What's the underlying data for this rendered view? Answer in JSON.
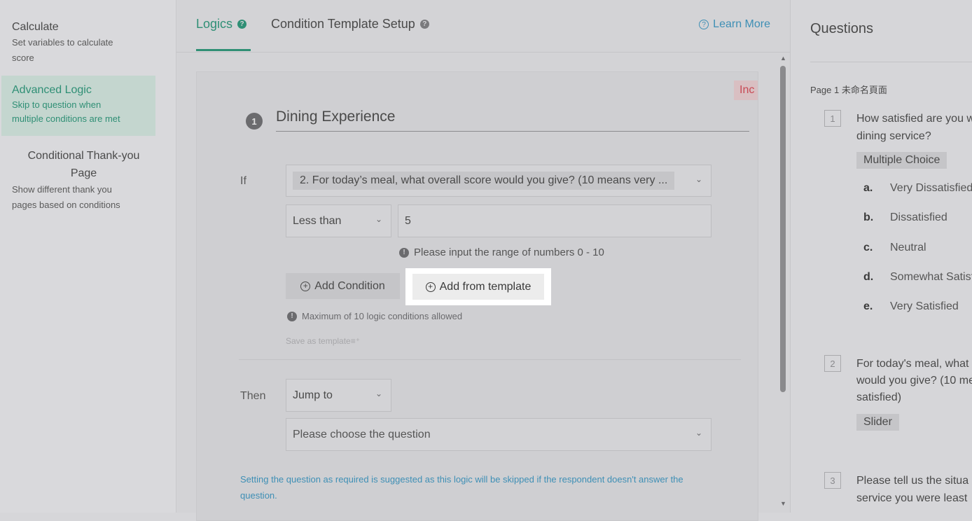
{
  "sidebar": {
    "calculate": {
      "title": "Calculate",
      "desc_line1": "Set variables to calculate",
      "desc_line2": "score"
    },
    "advanced": {
      "title": "Advanced Logic",
      "desc_line1": "Skip to question when",
      "desc_line2": "multiple conditions are met"
    },
    "thankyou": {
      "title_line1": "Conditional Thank-you",
      "title_line2": "Page",
      "desc_line1": "Show different thank you",
      "desc_line2": "pages based on conditions"
    }
  },
  "tabs": {
    "logics": "Logics",
    "template": "Condition Template Setup",
    "learn_more": "Learn More"
  },
  "rule": {
    "badge": "Inc",
    "number": "1",
    "title": "Dining Experience",
    "if_label": "If",
    "question": "2. For today’s meal, what overall score would you give? (10 means very ...",
    "operator": "Less than",
    "value": "5",
    "range_hint": "Please input the range of numbers 0 - 10",
    "add_condition": "Add Condition",
    "add_from_template": "Add from template",
    "max_hint": "Maximum of 10 logic conditions allowed",
    "save_template": "Save as template",
    "then_label": "Then",
    "action": "Jump to",
    "target_placeholder": "Please choose the question",
    "required_note_line1": "Setting the question as required is suggested as this logic will be skipped if the respondent doesn't answer the",
    "required_note_line2": "question."
  },
  "questions_panel": {
    "heading": "Questions",
    "page_label": "Page 1 未命名頁面",
    "q1": {
      "num": "1",
      "line1": "How satisfied are you w",
      "line2": "dining service?",
      "type": "Multiple Choice",
      "options": [
        {
          "key": "a.",
          "label": "Very Dissatisfied"
        },
        {
          "key": "b.",
          "label": "Dissatisfied"
        },
        {
          "key": "c.",
          "label": "Neutral"
        },
        {
          "key": "d.",
          "label": "Somewhat Satisfied"
        },
        {
          "key": "e.",
          "label": "Very Satisfied"
        }
      ]
    },
    "q2": {
      "num": "2",
      "line1": "For today's meal, what",
      "line2": "would you give? (10 me",
      "line3": "satisfied)",
      "type": "Slider"
    },
    "q3": {
      "num": "3",
      "line1": "Please tell us the situa",
      "line2": "service you were least"
    }
  },
  "colors": {
    "accent": "#2f8f75",
    "link": "#3e8fb5",
    "error": "#c84a55"
  },
  "icons": [
    "help-icon",
    "info-icon",
    "plus-circle-icon",
    "chevron-down-icon",
    "save-template-icon"
  ]
}
